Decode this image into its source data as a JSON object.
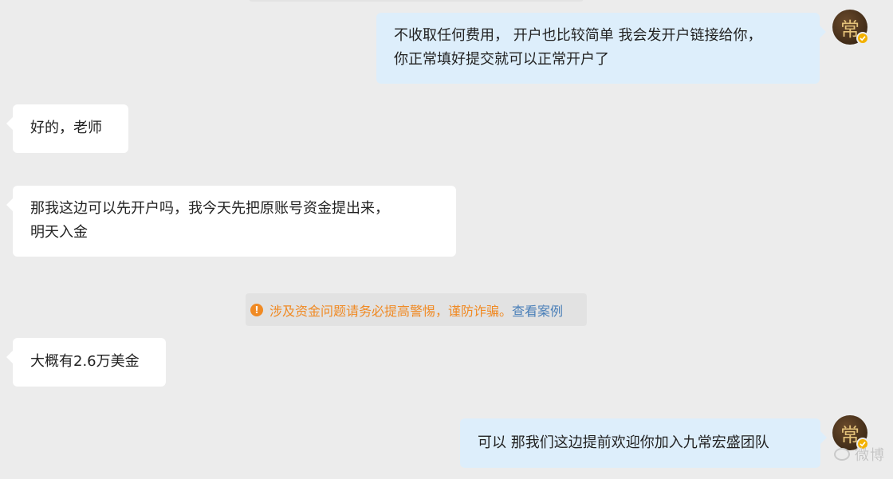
{
  "messages": [
    {
      "id": "m1",
      "side": "out",
      "text": "不收取任何费用， 开户也比较简单 我会发开户链接给你，\n你正常填好提交就可以正常开户了"
    },
    {
      "id": "m2",
      "side": "in",
      "text": "好的，老师"
    },
    {
      "id": "m3",
      "side": "in",
      "text": "那我这边可以先开户吗，我今天先把原账号资金提出来，\n明天入金"
    },
    {
      "id": "m4",
      "side": "in",
      "text": "大概有2.6万美金"
    },
    {
      "id": "m5",
      "side": "out",
      "text": "可以 那我们这边提前欢迎你加入九常宏盛团队"
    }
  ],
  "avatar": {
    "glyph": "常",
    "verified_icon": "verified-check-icon",
    "badge_color": "#f3b100"
  },
  "notice": {
    "icon": "info-icon",
    "warning_text": "涉及资金问题请务必提高警惕，谨防诈骗。",
    "link_text": "查看案例",
    "warning_color": "#f08a24",
    "link_color": "#4a7fb8"
  },
  "watermark": {
    "text": "微博"
  },
  "colors": {
    "background": "#ececec",
    "incoming_bubble": "#ffffff",
    "outgoing_bubble": "#ddeefb"
  }
}
